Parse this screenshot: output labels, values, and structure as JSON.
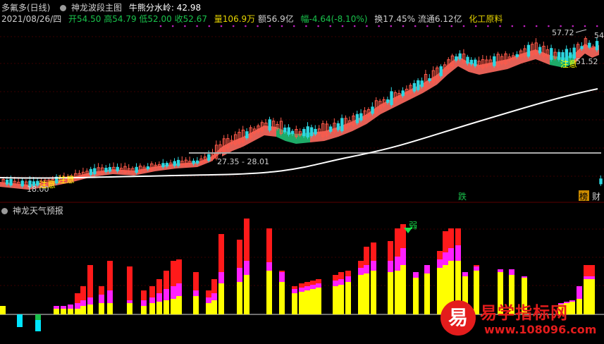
{
  "header": {
    "stock_name": "多氟多(日线)",
    "indicator_name": "神龙波段主图",
    "threshold_label": "牛熊分水岭:",
    "threshold_value": "42.98",
    "date": "2021/08/26/四",
    "open": "开54.50",
    "high": "高54.79",
    "low": "低52.00",
    "close": "收52.67",
    "volume": "量106.9万",
    "amount": "额56.9亿",
    "change": "幅-4.64(-8.10%)",
    "turnover": "换17.45%",
    "float": "流通6.12亿",
    "industry": "化工原料"
  },
  "main_chart": {
    "labels": {
      "high_marker": "57.72",
      "right_high": "54",
      "right_low": "51.52",
      "range_text": "27.35 - 28.01",
      "low_marker": "18.00",
      "note1": "注意",
      "note2": "注意",
      "note3": "注意",
      "signal_die": "跌",
      "badge_bang": "榜",
      "badge_cai": "财"
    },
    "colors": {
      "up": "#ff5a4a",
      "down": "#2ed6e0",
      "band": "#f0645a",
      "band_green": "#1fb46e",
      "ma": "#ffffff",
      "signal_dots": "#c020c0"
    }
  },
  "sub_chart": {
    "title": "神龙天气预报",
    "signal_weak": "弱",
    "colors": {
      "red": "#ff1a1a",
      "magenta": "#ff20ff",
      "yellow": "#ffff00",
      "cyan": "#00e5ff"
    }
  },
  "watermark": {
    "glyph": "易",
    "name": "易学指标网",
    "url": "www.108096.com"
  }
}
